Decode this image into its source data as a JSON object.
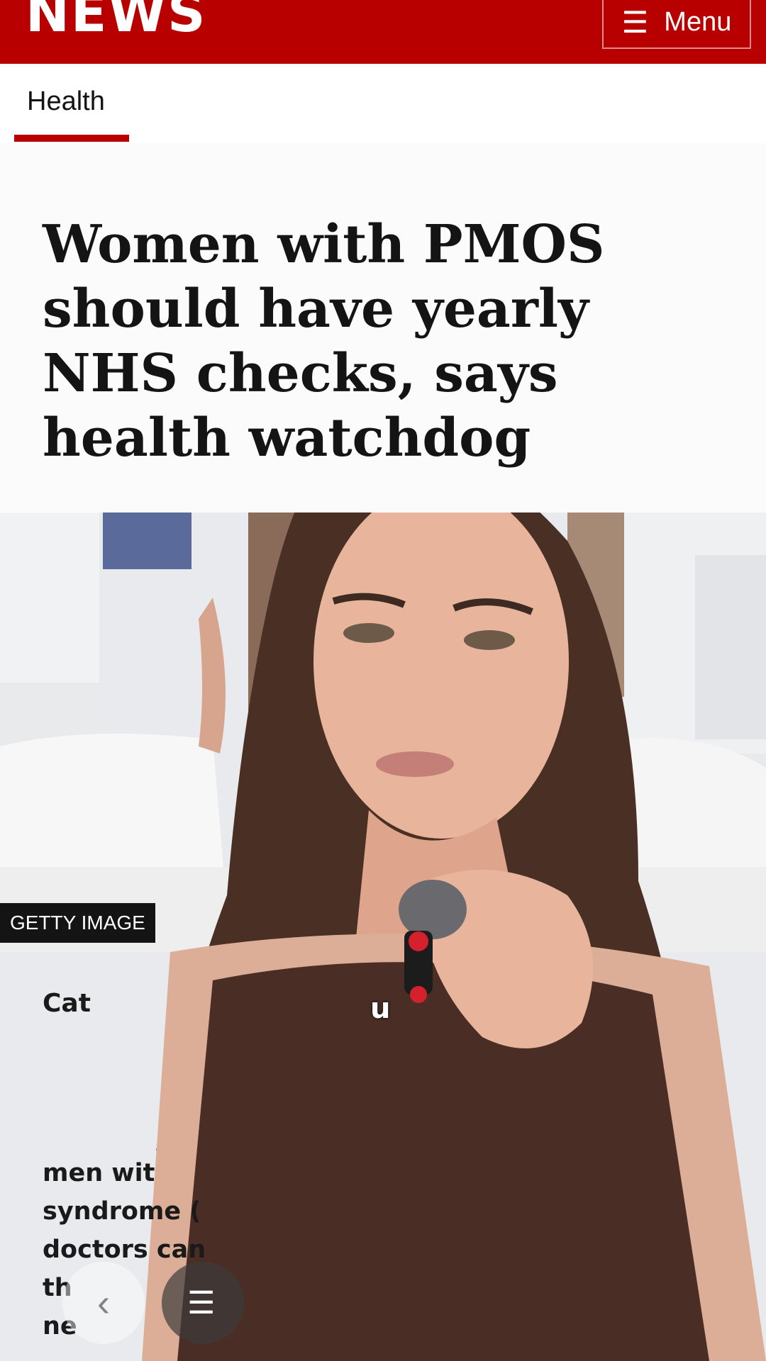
{
  "header": {
    "logo_text": "NEWS",
    "menu_icon": "hamburger-icon",
    "menu_label": "Menu",
    "brand_color": "#b80000"
  },
  "section_tab": {
    "label": "Health",
    "active": true
  },
  "article": {
    "headline": "Women with PMOS should have yearly NHS checks, says health watchdog",
    "image_credit": "GETTY IMAGE",
    "caption_partial": "Cat",
    "body_partial": [
      "men wit",
      "syndrome (",
      "doctors can",
      "th",
      "ne"
    ]
  },
  "video_overlay": {
    "subtitle_glyph": "u"
  },
  "controls": {
    "back_icon": "chevron-left-icon",
    "list_icon": "list-icon",
    "back_symbol": "‹",
    "list_symbol": "☰"
  }
}
